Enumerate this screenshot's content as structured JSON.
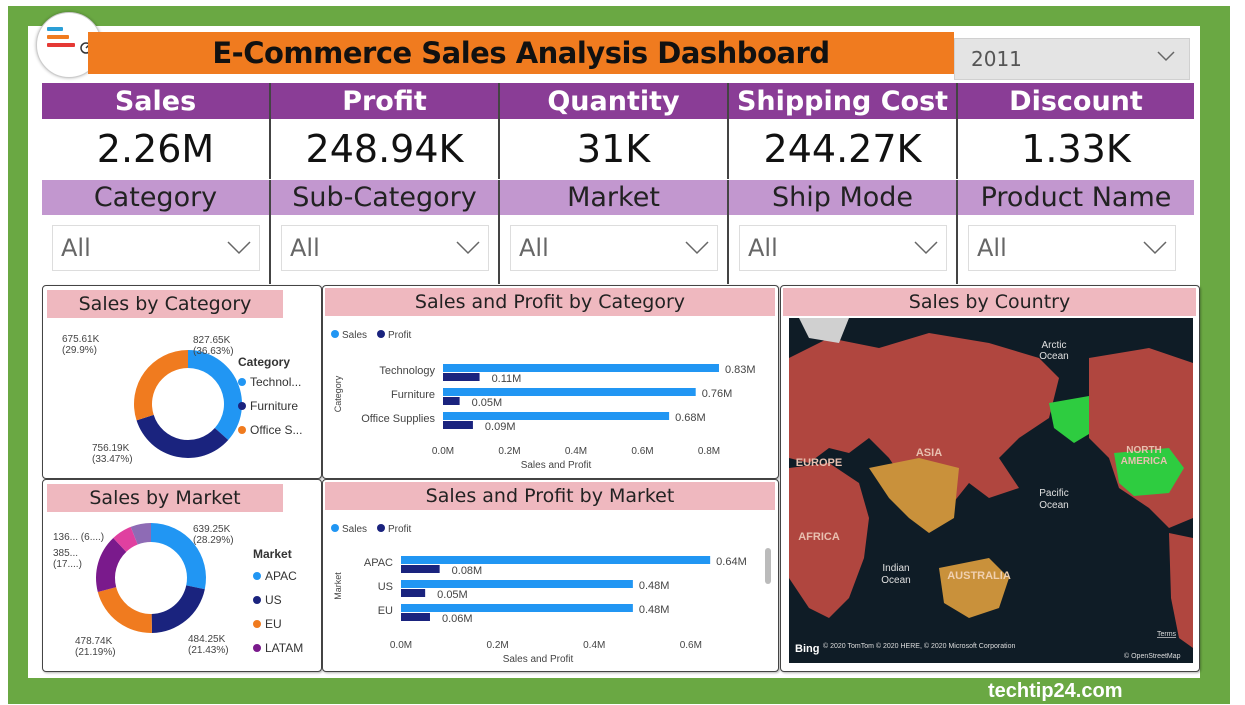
{
  "title": "E-Commerce Sales Analysis Dashboard",
  "year_filter": {
    "value": "2011"
  },
  "kpis": [
    {
      "label": "Sales",
      "value": "2.26M"
    },
    {
      "label": "Profit",
      "value": "248.94K"
    },
    {
      "label": "Quantity",
      "value": "31K"
    },
    {
      "label": "Shipping Cost",
      "value": "244.27K"
    },
    {
      "label": "Discount",
      "value": "1.33K"
    }
  ],
  "filters": [
    {
      "label": "Category",
      "value": "All"
    },
    {
      "label": "Sub-Category",
      "value": "All"
    },
    {
      "label": "Market",
      "value": "All"
    },
    {
      "label": "Ship Mode",
      "value": "All"
    },
    {
      "label": "Product Name",
      "value": "All"
    }
  ],
  "colors": {
    "sales": "#2196f3",
    "profit": "#1a237e",
    "third": "#f07b1f",
    "fourth": "#7a1a8c",
    "fifth": "#e040a0",
    "kpi_head": "#8a3d96",
    "filter_head": "#c297cf",
    "panel_title": "#efb8bf",
    "frame": "#6aa843"
  },
  "watermark": "techtip24.com",
  "chart_data": [
    {
      "type": "pie",
      "title": "Sales by Category",
      "legend_title": "Category",
      "legend": [
        "Technol...",
        "Furniture",
        "Office S..."
      ],
      "slices": [
        {
          "label": "827.65K",
          "pct": "(36.63%)",
          "value": 827.65
        },
        {
          "label": "756.19K",
          "pct": "(33.47%)",
          "value": 756.19
        },
        {
          "label": "675.61K",
          "pct": "(29.9%)",
          "value": 675.61
        }
      ]
    },
    {
      "type": "bar",
      "title": "Sales and Profit by Category",
      "legend": [
        "Sales",
        "Profit"
      ],
      "ylabel": "Category",
      "xlabel": "Sales and Profit",
      "categories": [
        "Technology",
        "Furniture",
        "Office Supplies"
      ],
      "series": [
        {
          "name": "Sales",
          "values": [
            0.83,
            0.76,
            0.68
          ],
          "labels": [
            "0.83M",
            "0.76M",
            "0.68M"
          ]
        },
        {
          "name": "Profit",
          "values": [
            0.11,
            0.05,
            0.09
          ],
          "labels": [
            "0.11M",
            "0.05M",
            "0.09M"
          ]
        }
      ],
      "xticks": [
        "0.0M",
        "0.2M",
        "0.4M",
        "0.6M",
        "0.8M"
      ],
      "xlim": [
        0,
        0.8
      ]
    },
    {
      "type": "pie",
      "title": "Sales by Market",
      "legend_title": "Market",
      "legend": [
        "APAC",
        "US",
        "EU",
        "LATAM"
      ],
      "slices": [
        {
          "label": "639.25K",
          "pct": "(28.29%)",
          "value": 639.25
        },
        {
          "label": "484.25K",
          "pct": "(21.43%)",
          "value": 484.25
        },
        {
          "label": "478.74K",
          "pct": "(21.19%)",
          "value": 478.74
        },
        {
          "label": "385...",
          "pct": "(17....)",
          "value": 385
        },
        {
          "label": "136... (6....)",
          "pct": "",
          "value": 136
        },
        {
          "label": "",
          "pct": "",
          "value": 136
        }
      ]
    },
    {
      "type": "bar",
      "title": "Sales and Profit by Market",
      "legend": [
        "Sales",
        "Profit"
      ],
      "ylabel": "Market",
      "xlabel": "Sales and Profit",
      "categories": [
        "APAC",
        "US",
        "EU"
      ],
      "series": [
        {
          "name": "Sales",
          "values": [
            0.64,
            0.48,
            0.48
          ],
          "labels": [
            "0.64M",
            "0.48M",
            "0.48M"
          ]
        },
        {
          "name": "Profit",
          "values": [
            0.08,
            0.05,
            0.06
          ],
          "labels": [
            "0.08M",
            "0.05M",
            "0.06M"
          ]
        }
      ],
      "xticks": [
        "0.0M",
        "0.2M",
        "0.4M",
        "0.6M"
      ],
      "xlim": [
        0,
        0.65
      ]
    }
  ],
  "map": {
    "title": "Sales by Country",
    "labels": [
      "Arctic Ocean",
      "EUROPE",
      "ASIA",
      "NORTH AMERICA",
      "Pacific Ocean",
      "AFRICA",
      "Indian Ocean",
      "AUSTRALIA"
    ],
    "attribution": "© 2020 TomTom © 2020 HERE, © 2020 Microsoft Corporation",
    "terms": "Terms",
    "osm": "© OpenStreetMap",
    "brand": "Bing"
  }
}
